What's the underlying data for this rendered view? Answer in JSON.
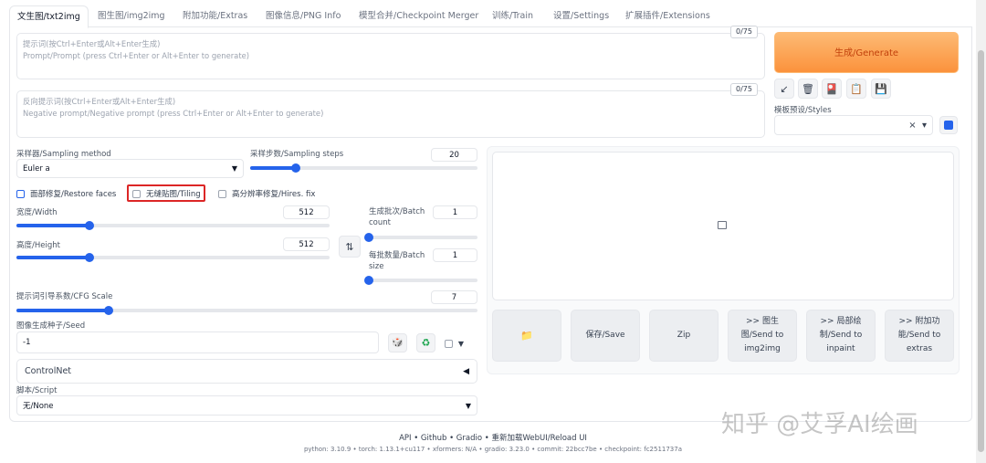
{
  "tabs": [
    {
      "label": "文生图/txt2img",
      "active": true
    },
    {
      "label": "图生图/img2img"
    },
    {
      "label": "附加功能/Extras"
    },
    {
      "label": "图像信息/PNG Info"
    },
    {
      "label": "模型合并/Checkpoint Merger"
    },
    {
      "label": "训练/Train"
    },
    {
      "label": "设置/Settings"
    },
    {
      "label": "扩展插件/Extensions"
    }
  ],
  "prompt": {
    "placeholder_line1": "提示词(按Ctrl+Enter或Alt+Enter生成)",
    "placeholder_line2": "Prompt/Prompt (press Ctrl+Enter or Alt+Enter to generate)",
    "counter": "0/75"
  },
  "negative_prompt": {
    "placeholder_line1": "反向提示词(按Ctrl+Enter或Alt+Enter生成)",
    "placeholder_line2": "Negative prompt/Negative prompt (press Ctrl+Enter or Alt+Enter to generate)",
    "counter": "0/75"
  },
  "generate_label": "生成/Generate",
  "tools": {
    "icons": [
      "arrow-diagonal-icon",
      "trash-icon",
      "red-card-icon",
      "clipboard-icon",
      "save-disk-icon"
    ],
    "glyphs": [
      "↙",
      "🗑",
      "🎴",
      "📋",
      "💾"
    ]
  },
  "styles": {
    "label": "模板预设/Styles",
    "clear": "×",
    "arrow": "▾"
  },
  "refresh_glyph": "🔄",
  "sampling_method": {
    "label": "采样器/Sampling method",
    "value": "Euler a"
  },
  "sampling_steps": {
    "label": "采样步数/Sampling steps",
    "value": "20",
    "level": 0.2
  },
  "restore_faces": {
    "label": "面部修复/Restore faces",
    "checked": false
  },
  "tiling": {
    "label": "无缝贴图/Tiling",
    "checked": false
  },
  "hires_fix": {
    "label": "高分辨率修复/Hires. fix",
    "checked": false
  },
  "width": {
    "label": "宽度/Width",
    "value": "512",
    "level": 0.233
  },
  "height": {
    "label": "高度/Height",
    "value": "512",
    "level": 0.233
  },
  "swap_glyph": "⇅",
  "batch_count": {
    "label_line1": "生成批次/Batch",
    "label_line2": "count",
    "value": "1",
    "level": 0.0
  },
  "batch_size": {
    "label_line1": "每批数量/Batch",
    "label_line2": "size",
    "value": "1",
    "level": 0.0
  },
  "cfg_scale": {
    "label": "提示词引导系数/CFG Scale",
    "value": "7",
    "level": 0.2
  },
  "seed": {
    "label": "图像生成种子/Seed",
    "value": "-1"
  },
  "seed_icons": {
    "dice": "🎲",
    "recycle": "♻",
    "arrow": "▼"
  },
  "controlnet": {
    "label": "ControlNet",
    "arrow": "◀"
  },
  "script": {
    "label": "脚本/Script",
    "value": "无/None",
    "arrow": "▾"
  },
  "output_image_icon": "🖼",
  "actions": [
    {
      "name": "open-folder-button",
      "label": "📁"
    },
    {
      "name": "save-button",
      "label": "保存/Save"
    },
    {
      "name": "zip-button",
      "label": "Zip"
    },
    {
      "name": "send-to-img2img-button",
      "label": ">> 图生\n图/Send to\nimg2img"
    },
    {
      "name": "send-to-inpaint-button",
      "label": ">> 局部绘\n制/Send to\ninpaint"
    },
    {
      "name": "send-to-extras-button",
      "label": ">> 附加功\n能/Send to\nextras"
    }
  ],
  "footer": {
    "links": "API  •  Github  •  Gradio  •  重新加载WebUI/Reload UI",
    "versions": "python: 3.10.9  •  torch: 1.13.1+cu117  •  xformers: N/A  •  gradio: 3.23.0  •  commit: 22bcc7be  •  checkpoint: fc2511737a"
  },
  "watermark": "知乎 @艾孚AI绘画",
  "colors": {
    "accent": "#2563eb",
    "generate": "#fb923c",
    "highlight": "#dc2626"
  }
}
